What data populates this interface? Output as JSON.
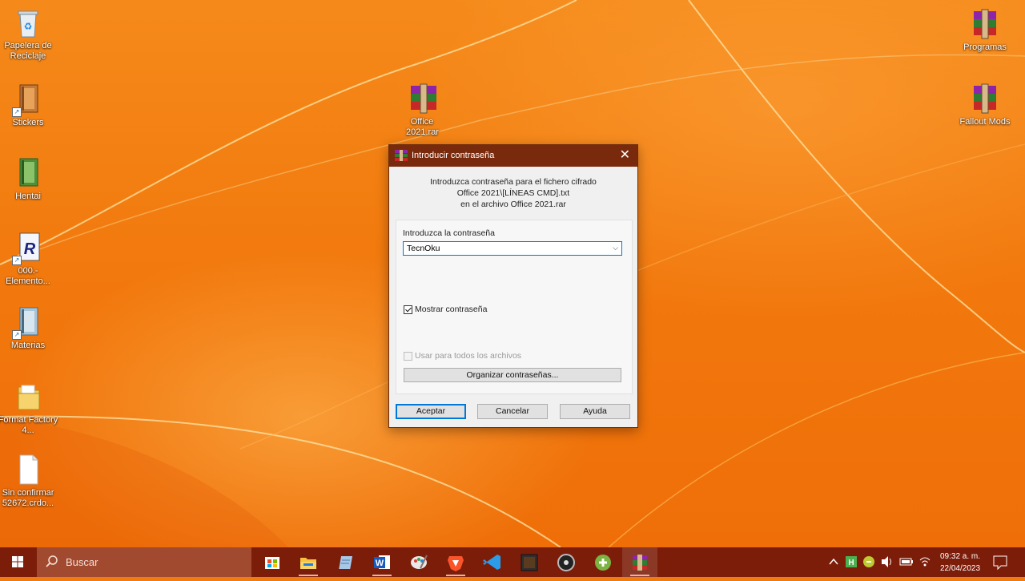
{
  "desktop": {
    "left_icons": [
      {
        "label": "Papelera de Reciclaje",
        "icon": "recycle-bin-icon"
      },
      {
        "label": "Stickers",
        "icon": "folder-book-icon"
      },
      {
        "label": "Hentai",
        "icon": "folder-green-icon"
      },
      {
        "label": "000.- Elemento...",
        "icon": "app-r-icon"
      },
      {
        "label": "Materias",
        "icon": "folder-blue-icon"
      },
      {
        "label": "Format Factory 4...",
        "icon": "folder-icon"
      },
      {
        "label": "Sin confirmar 52672.crdo...",
        "icon": "blank-file-icon"
      }
    ],
    "center_icon": {
      "label": "Office 2021.rar",
      "icon": "winrar-archive-icon"
    },
    "right_icons": [
      {
        "label": "Programas",
        "icon": "winrar-archive-icon"
      },
      {
        "label": "Fallout Mods",
        "icon": "winrar-archive-icon"
      }
    ]
  },
  "dialog": {
    "title": "Introducir contraseña",
    "info_line1": "Introduzca contraseña para el fichero cifrado",
    "info_line2": "Office 2021\\[LÍNEAS CMD].txt",
    "info_line3": "en el archivo Office 2021.rar",
    "password_label": "Introduzca la contraseña",
    "password_value": "TecnOku",
    "show_password_label": "Mostrar contraseña",
    "show_password_checked": true,
    "use_all_label": "Usar para todos los archivos",
    "use_all_checked": false,
    "organize_label": "Organizar contraseñas...",
    "ok_label": "Aceptar",
    "cancel_label": "Cancelar",
    "help_label": "Ayuda"
  },
  "taskbar": {
    "search_placeholder": "Buscar",
    "apps": [
      "store-icon",
      "file-explorer-icon",
      "notepad-icon",
      "word-icon",
      "paint-icon",
      "brave-icon",
      "vscode-icon",
      "minecraft-icon",
      "media-icon",
      "green-app-icon",
      "winrar-icon"
    ],
    "clock_time": "09:32 a. m.",
    "clock_date": "22/04/2023"
  },
  "colors": {
    "titlebar": "#7a2a0c",
    "taskbar": "#7c1d0a",
    "accent": "#0078d7"
  }
}
